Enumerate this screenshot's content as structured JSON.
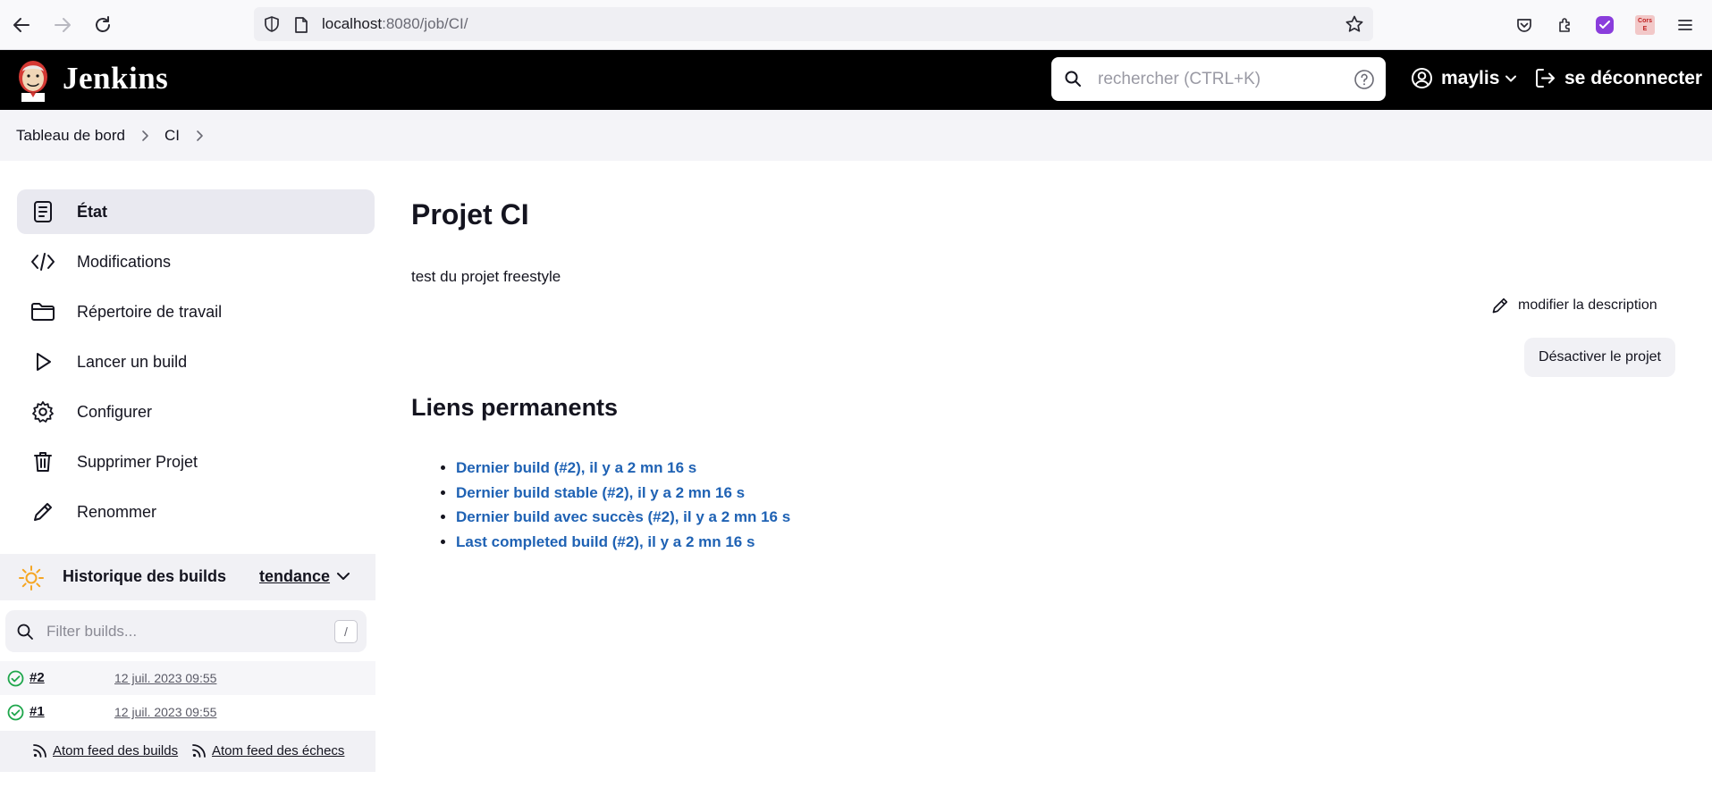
{
  "browser": {
    "url_host": "localhost",
    "url_rest": ":8080/job/CI/",
    "extension_badge_label": "Cors E"
  },
  "header": {
    "brand": "Jenkins",
    "search_placeholder": "rechercher (CTRL+K)",
    "user_name": "maylis",
    "logout_label": "se déconnecter"
  },
  "breadcrumb": {
    "items": [
      "Tableau de bord",
      "CI"
    ]
  },
  "sidebar": {
    "tasks": [
      {
        "label": "État",
        "icon": "status-icon",
        "active": true
      },
      {
        "label": "Modifications",
        "icon": "code-icon",
        "active": false
      },
      {
        "label": "Répertoire de travail",
        "icon": "folder-icon",
        "active": false
      },
      {
        "label": "Lancer un build",
        "icon": "play-icon",
        "active": false
      },
      {
        "label": "Configurer",
        "icon": "gear-icon",
        "active": false
      },
      {
        "label": "Supprimer Projet",
        "icon": "trash-icon",
        "active": false
      },
      {
        "label": "Renommer",
        "icon": "pencil-icon",
        "active": false
      }
    ]
  },
  "build_history": {
    "title": "Historique des builds",
    "trend_label": "tendance",
    "filter_placeholder": "Filter builds...",
    "filter_shortcut": "/",
    "builds": [
      {
        "number": "#2",
        "date": "12 juil. 2023 09:55",
        "status": "success"
      },
      {
        "number": "#1",
        "date": "12 juil. 2023 09:55",
        "status": "success"
      }
    ],
    "feed_all_label": "Atom feed des builds",
    "feed_failures_label": "Atom feed des échecs"
  },
  "main": {
    "title": "Projet CI",
    "description": "test du projet freestyle",
    "edit_description_label": "modifier la description",
    "disable_button_label": "Désactiver le projet",
    "permalinks_title": "Liens permanents",
    "permalinks": [
      "Dernier build (#2), il y a 2 mn 16 s",
      "Dernier build stable (#2), il y a 2 mn 16 s",
      "Dernier build avec succès (#2), il y a 2 mn 16 s",
      "Last completed build (#2), il y a 2 mn 16 s"
    ]
  },
  "colors": {
    "header_bg": "#000000",
    "link_blue": "#1f62b4",
    "success_green": "#1ea64b",
    "sun_orange": "#f5a623"
  }
}
